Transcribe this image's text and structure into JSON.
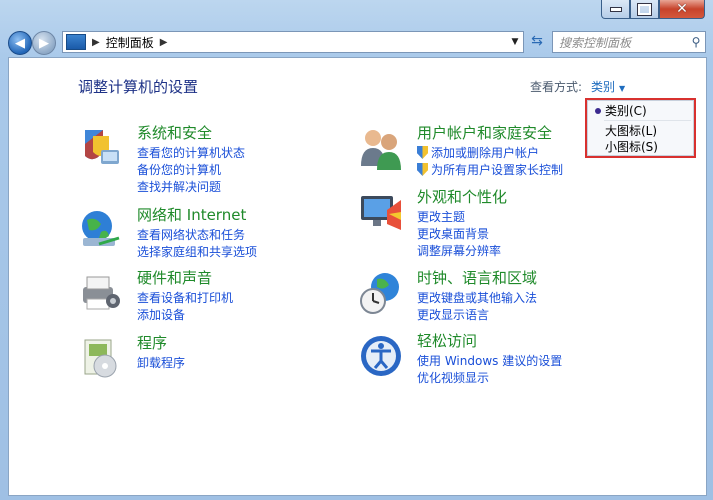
{
  "breadcrumb": {
    "location": "控制面板"
  },
  "search": {
    "placeholder": "搜索控制面板"
  },
  "page": {
    "title": "调整计算机的设置"
  },
  "view_by": {
    "label": "查看方式:",
    "value": "类别",
    "options": [
      {
        "label": "类别(C)",
        "selected": true
      },
      {
        "label": "大图标(L)",
        "selected": false
      },
      {
        "label": "小图标(S)",
        "selected": false
      }
    ]
  },
  "categories_left": [
    {
      "title": "系统和安全",
      "icon": "system-security-icon",
      "links": [
        "查看您的计算机状态",
        "备份您的计算机",
        "查找并解决问题"
      ]
    },
    {
      "title": "网络和 Internet",
      "icon": "network-icon",
      "links": [
        "查看网络状态和任务",
        "选择家庭组和共享选项"
      ]
    },
    {
      "title": "硬件和声音",
      "icon": "hardware-sound-icon",
      "links": [
        "查看设备和打印机",
        "添加设备"
      ]
    },
    {
      "title": "程序",
      "icon": "programs-icon",
      "links": [
        "卸载程序"
      ]
    }
  ],
  "categories_right": [
    {
      "title": "用户帐户和家庭安全",
      "icon": "user-accounts-icon",
      "links": [
        "添加或删除用户帐户",
        "为所有用户设置家长控制"
      ]
    },
    {
      "title": "外观和个性化",
      "icon": "appearance-icon",
      "links": [
        "更改主题",
        "更改桌面背景",
        "调整屏幕分辨率"
      ]
    },
    {
      "title": "时钟、语言和区域",
      "icon": "clock-language-icon",
      "links": [
        "更改键盘或其他输入法",
        "更改显示语言"
      ]
    },
    {
      "title": "轻松访问",
      "icon": "ease-of-access-icon",
      "links": [
        "使用 Windows 建议的设置",
        "优化视频显示"
      ]
    }
  ],
  "colors": {
    "title": "#1e3287",
    "category": "#1f8a2a",
    "link": "#1a4fd8",
    "highlight": "#d8312f"
  }
}
